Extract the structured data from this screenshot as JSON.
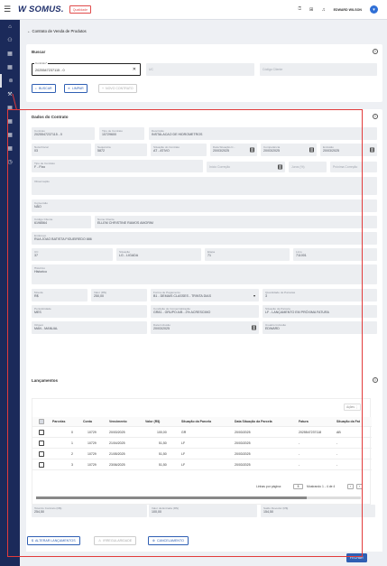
{
  "topbar": {
    "logo": "W SOMUS.",
    "badge": "Qualidade",
    "icons": [
      "help-icon",
      "apps-icon",
      "bell-icon"
    ],
    "user": "EDWARD WILSON"
  },
  "sidebar": {
    "icons": [
      "home-icon",
      "users-icon",
      "grid-icon",
      "grid-icon",
      "grid-icon",
      "broadcast-icon",
      "tool-icon",
      "grid-icon",
      "grid-icon",
      "grid-icon",
      "grid-icon",
      "clock-icon"
    ]
  },
  "breadcrumb": "Contrato de Venda de Produtos",
  "buscar": {
    "title": "Buscar",
    "contrato_label": "Contrato*",
    "contrato_value": "2025547237115 - 0",
    "uc_placeholder": "UC",
    "codigo_placeholder": "Código Cliente",
    "btn_buscar": "BUSCAR",
    "btn_limpar": "LIMPAR",
    "btn_novo": "NOVO CONTRATO"
  },
  "dados": {
    "title": "Dados do Contrato",
    "contrato": {
      "label": "Contrato",
      "value": "2025547237115 - 0"
    },
    "tipo": {
      "label": "Tipo de Contrato",
      "value": "10729600"
    },
    "descricao": {
      "label": "Descrição",
      "value": "INSTALACAO DE HIDROMETROS"
    },
    "nota": {
      "label": "Nota Fiscal",
      "value": "03"
    },
    "sequencia": {
      "label": "Sequência",
      "value": "5872"
    },
    "situacao": {
      "label": "Situação do Contrato",
      "value": "AT - ATIVO"
    },
    "data_situacao": {
      "label": "Data Situação C...",
      "value": "20/03/2025"
    },
    "competencia": {
      "label": "Competência",
      "value": "20/03/2025"
    },
    "emissao": {
      "label": "Emissão",
      "value": "20/03/2025"
    },
    "tipo_contrato2": {
      "label": "Tipo de Contrato",
      "value": "F - Fixo"
    },
    "inicio_correcao": "Início Correção",
    "juros": "Juros (%)",
    "proxima_correcao": "Próxima Correção",
    "observacao": "Observação",
    "conversao": {
      "label": "Conversão",
      "value": "NÃO"
    },
    "codigo_cliente": {
      "label": "Código Cliente",
      "value": "6198564"
    },
    "nome_cliente": {
      "label": "Nome Cliente",
      "value": "ELLEM CHRISTINE RAMOS AMORIM"
    },
    "endereco": {
      "label": "Endereço",
      "value": "RUA JOAO BATISTA FIGUEIREDO 886"
    },
    "uc": {
      "label": "UC",
      "value": "37"
    },
    "situacao2": {
      "label": "Situação",
      "value": "LG - LIGADA"
    },
    "etapa": {
      "label": "Etapa",
      "value": "71"
    },
    "livro": {
      "label": "Livro",
      "value": "711001"
    },
    "historico": {
      "label": "Histórico",
      "value": "Historico"
    },
    "moeda": {
      "label": "Moeda",
      "value": "R$"
    },
    "valor": {
      "label": "Valor (R$)",
      "value": "250,00"
    },
    "forma_pagamento": {
      "label": "Forma de Pagamento",
      "value": "B1 - DEMAIS CLASSES - TRINTA DIAS"
    },
    "qtd_parcelas": {
      "label": "Quantidade de Parcelas",
      "value": "3"
    },
    "periodicidade": {
      "label": "Periodicidade",
      "value": "MES"
    },
    "condicao": {
      "label": "Condição de Comercialização",
      "value": "GR81 - GRUPO A/B - 2% ACRESCIMO"
    },
    "situacao_parcela": {
      "label": "Situação da Parcela",
      "value": "LF - LANÇAMENTO EM PRÓXIMA FATURA"
    },
    "origem": {
      "label": "Origem",
      "value": "MAN - MANUAL"
    },
    "data_inclusao": {
      "label": "Data Inclusão",
      "value": "20/03/2025"
    },
    "usuario": {
      "label": "Usuário Inclusão",
      "value": "EDWARD"
    }
  },
  "lancamentos": {
    "title": "Lançamentos",
    "acoes": "Ações",
    "columns": [
      "Parcelas",
      "Conta",
      "Vencimento",
      "Valor (R$)",
      "Situação da Parcela",
      "Data Situação da Parcela",
      "Fatura",
      "Situação da Fat"
    ],
    "rows": [
      [
        "0",
        "10729",
        "20/03/2025",
        "100,00",
        "GR",
        "20/03/2025",
        "2025547237118",
        "AB"
      ],
      [
        "1",
        "10729",
        "21/04/2025",
        "51,50",
        "LF",
        "20/03/2025",
        "-",
        "-"
      ],
      [
        "2",
        "10729",
        "21/05/2025",
        "51,50",
        "LF",
        "20/03/2025",
        "-",
        "-"
      ],
      [
        "3",
        "10729",
        "23/06/2025",
        "51,50",
        "LF",
        "20/03/2025",
        "-",
        "-"
      ]
    ],
    "linhas_label": "Linhas por página:",
    "linhas_value": "5",
    "mostrando": "Mostrando 1 - 4 de 4",
    "total": {
      "label": "Total do Contrato (R$)",
      "value": "254,50"
    },
    "entrada": {
      "label": "Valor da Entrada (R$)",
      "value": "100,00"
    },
    "saldo": {
      "label": "Saldo Devedor (R$)",
      "value": "154,50"
    }
  },
  "footer": {
    "alterar": "ALTERAR LANÇAMENTOS",
    "irregularidade": "IRREGULARIDADE",
    "cancelamento": "CANCELAMENTO",
    "fechar": "FECHAR"
  }
}
